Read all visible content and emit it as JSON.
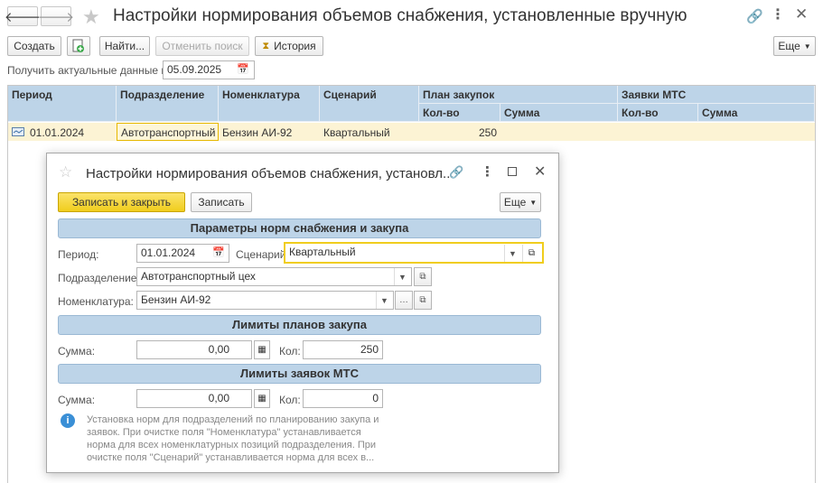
{
  "window": {
    "title": "Настройки нормирования объемов снабжения, установленные вручную"
  },
  "toolbar": {
    "create_label": "Создать",
    "find_label": "Найти...",
    "cancel_search_label": "Отменить поиск",
    "history_label": "История",
    "more_label": "Еще"
  },
  "actual_date": {
    "label": "Получить актуальные данные на:",
    "value": "05.09.2025"
  },
  "table": {
    "headers": {
      "period": "Период",
      "division": "Подразделение",
      "nomenclature": "Номенклатура",
      "scenario": "Сценарий",
      "purchase_plan": "План закупок",
      "mts_requests": "Заявки МТС",
      "qty": "Кол-во",
      "sum": "Сумма"
    },
    "rows": [
      {
        "period": "01.01.2024",
        "division": "Автотранспортный",
        "nomenclature": "Бензин АИ-92",
        "scenario": "Квартальный",
        "plan_qty": "250",
        "plan_sum": "",
        "mts_qty": "",
        "mts_sum": ""
      }
    ]
  },
  "dialog": {
    "title": "Настройки нормирования объемов снабжения, установл...",
    "save_close_label": "Записать и закрыть",
    "save_label": "Записать",
    "more_label": "Еще",
    "section_params": "Параметры норм снабжения и закупа",
    "period_label": "Период:",
    "period_value": "01.01.2024",
    "scenario_label": "Сценарий:",
    "scenario_value": "Квартальный",
    "division_label": "Подразделение:",
    "division_value": "Автотранспортный цех",
    "nomenclature_label": "Номенклатура:",
    "nomenclature_value": "Бензин АИ-92",
    "section_plan_limits": "Лимиты планов закупа",
    "plan_sum_label": "Сумма:",
    "plan_sum_value": "0,00",
    "plan_qty_label": "Кол:",
    "plan_qty_value": "250",
    "section_mts_limits": "Лимиты заявок МТС",
    "mts_sum_label": "Сумма:",
    "mts_sum_value": "0,00",
    "mts_qty_label": "Кол:",
    "mts_qty_value": "0",
    "info_text": "Установка норм для подразделений по планированию закупа и заявок. При очистке поля \"Номенклатура\" устанавливается норма для всех номенклатурных позиций подразделения. При очистке поля \"Сценарий\" устанавливается норма для всех в..."
  },
  "colors": {
    "accent_yellow": "#f5d53a",
    "header_blue": "#bdd4e8",
    "row_selected": "#fcf3d4"
  }
}
